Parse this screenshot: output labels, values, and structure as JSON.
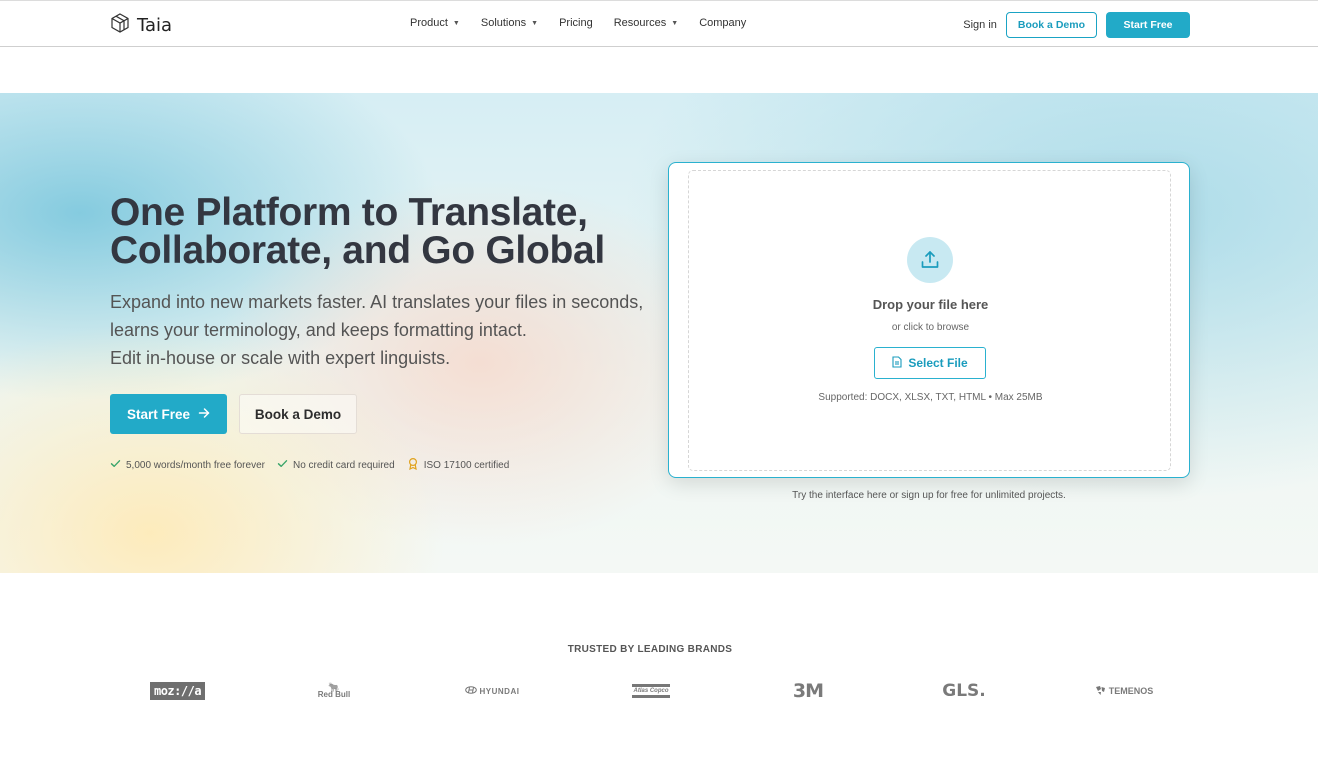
{
  "nav": {
    "logo_text": "Taia",
    "links": [
      {
        "label": "Product",
        "has_dropdown": true
      },
      {
        "label": "Solutions",
        "has_dropdown": true
      },
      {
        "label": "Pricing",
        "has_dropdown": false
      },
      {
        "label": "Resources",
        "has_dropdown": true
      },
      {
        "label": "Company",
        "has_dropdown": false
      }
    ],
    "sign_in": "Sign in",
    "book_demo": "Book a Demo",
    "start_free": "Start Free",
    "caret": "▼"
  },
  "hero": {
    "title_line1": "One Platform to Translate,",
    "title_line2": "Collaborate, and Go Global",
    "subtitle_lines": [
      "Expand into new markets faster. AI translates your files in seconds,",
      "learns your terminology, and keeps formatting intact.",
      "Edit in-house or scale with expert linguists."
    ],
    "start_free": "Start Free",
    "book_demo": "Book a Demo",
    "features": [
      {
        "label": "5,000 words/month free forever",
        "icon": "check-icon"
      },
      {
        "label": "No credit card required",
        "icon": "check-icon"
      },
      {
        "label": "ISO 17100 certified",
        "icon": "award-icon"
      }
    ]
  },
  "upload": {
    "title": "Drop your file here",
    "subtitle": "or click to browse",
    "select_button": "Select File",
    "supported": "Supported: DOCX, XLSX, TXT, HTML • Max 25MB",
    "note": "Try the interface here or sign up for free for unlimited projects."
  },
  "brands": {
    "heading": "TRUSTED BY LEADING BRANDS",
    "logos": {
      "mozilla": "moz://a",
      "redbull_top": "🐂",
      "redbull": "Red Bull",
      "hyundai": "HYUNDAI",
      "atlas": "Atlas Copco",
      "m3": "3M",
      "gls": "GLS.",
      "temenos": "TEMENOS"
    }
  },
  "colors": {
    "accent": "#22aac8",
    "accent_text": "#1a9cbd",
    "title": "#333741",
    "check": "#3aa56a",
    "award": "#e0a21c"
  }
}
